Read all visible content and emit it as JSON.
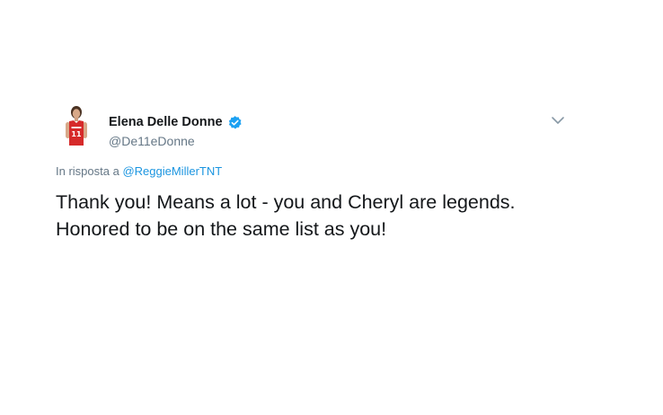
{
  "author": {
    "name": "Elena Delle Donne",
    "handle": "@De11eDonne",
    "verified": true,
    "avatar_icon": "player-avatar",
    "jersey_number": "11"
  },
  "reply": {
    "prefix": "In risposta a",
    "mention": "@ReggieMillerTNT"
  },
  "tweet": {
    "lines": [
      "Thank you! Means a lot - you and Cheryl are legends.",
      "Honored to be on the same list as you!"
    ]
  },
  "menu": {
    "icon": "chevron-down-icon"
  },
  "colors": {
    "verified": "#1da1f2",
    "link": "#1b95e0",
    "secondary_text": "#657786",
    "jersey": "#d62a2a"
  }
}
